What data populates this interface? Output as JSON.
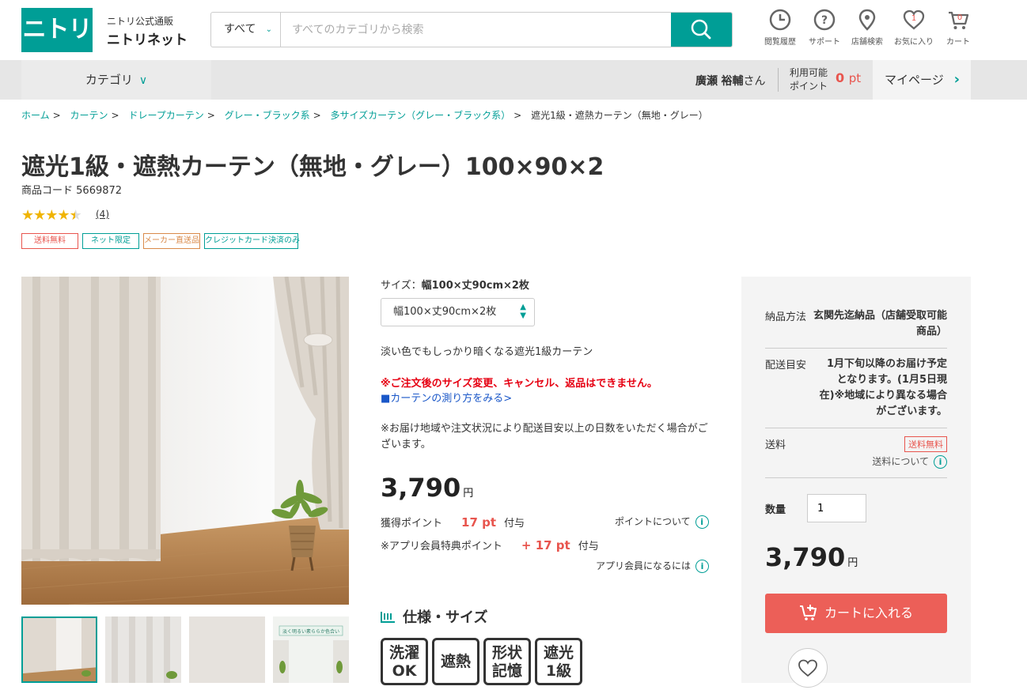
{
  "header": {
    "logo": "ニトリ",
    "brand_sub": "ニトリ公式通販",
    "brand_main": "ニトリネット",
    "search_category": "すべて",
    "search_placeholder": "すべてのカテゴリから検索",
    "icons": [
      {
        "label": "閲覧履歴",
        "icon": "history-icon"
      },
      {
        "label": "サポート",
        "icon": "help-icon"
      },
      {
        "label": "店舗検索",
        "icon": "map-pin-icon"
      },
      {
        "label": "お気に入り",
        "icon": "heart-icon",
        "count": "1"
      },
      {
        "label": "カート",
        "icon": "cart-icon",
        "count": "0"
      }
    ]
  },
  "nav": {
    "category": "カテゴリ",
    "user_family": "廣瀬",
    "user_given": "裕輔",
    "user_suffix": "さん",
    "points_label_1": "利用可能",
    "points_label_2": "ポイント",
    "points_value": "0",
    "points_unit": "pt",
    "mypage": "マイページ"
  },
  "breadcrumb": [
    "ホーム",
    "カーテン",
    "ドレープカーテン",
    "グレー・ブラック系",
    "多サイズカーテン（グレー・ブラック系）"
  ],
  "breadcrumb_current": "遮光1級・遮熱カーテン（無地・グレー）",
  "product": {
    "title": "遮光1級・遮熱カーテン（無地・グレー）100×90×2",
    "code_label": "商品コード",
    "code": "5669872",
    "rating": 4.5,
    "review_count": "(4)",
    "tags": [
      "送料無料",
      "ネット限定",
      "メーカー直送品",
      "クレジットカード決済のみ"
    ],
    "size_label": "サイズ：",
    "size_value": "幅100×丈90cm×2枚",
    "size_select": "幅100×丈90cm×2枚",
    "description": "淡い色でもしっかり暗くなる遮光1級カーテン",
    "warning": "※ご注文後のサイズ変更、キャンセル、返品はできません。",
    "measure_link": "■カーテンの測り方をみる>",
    "delivery_note": "※お届け地域や注文状況により配送目安以上の日数をいただく場合がございます。",
    "price": "3,790",
    "currency": "円",
    "points_label": "獲得ポイント",
    "points": "17 pt",
    "points_suffix": "付与",
    "points_info": "ポイントについて",
    "app_points_label": "※アプリ会員特典ポイント",
    "app_points": "+ 17 pt",
    "app_points_suffix": "付与",
    "app_info": "アプリ会員になるには",
    "spec_heading": "仕様・サイズ",
    "badges": [
      {
        "line1": "洗濯",
        "line2": "OK"
      },
      {
        "line1": "",
        "line2": "遮熱"
      },
      {
        "line1": "形状",
        "line2": "記憶"
      },
      {
        "line1": "遮光",
        "line2": "1級"
      }
    ],
    "thumb_text": "淡く明るい素ららか色合い"
  },
  "panel": {
    "delivery_method_label": "納品方法",
    "delivery_method": "玄関先迄納品（店舗受取可能商品）",
    "delivery_eta_label": "配送目安",
    "delivery_eta": "1月下旬以降のお届け予定となります。(1月5日現在)※地域により異なる場合がございます。",
    "shipping_label": "送料",
    "shipping_tag": "送料無料",
    "shipping_info": "送料について",
    "qty_label": "数量",
    "qty_value": "1",
    "price": "3,790",
    "currency": "円",
    "cart_button": "カートに入れる"
  },
  "colors": {
    "brand": "#009e96",
    "accent_red": "#e8554e",
    "cart_button": "#ec5f58",
    "warning": "#e60012",
    "link_blue": "#1a57c8"
  }
}
